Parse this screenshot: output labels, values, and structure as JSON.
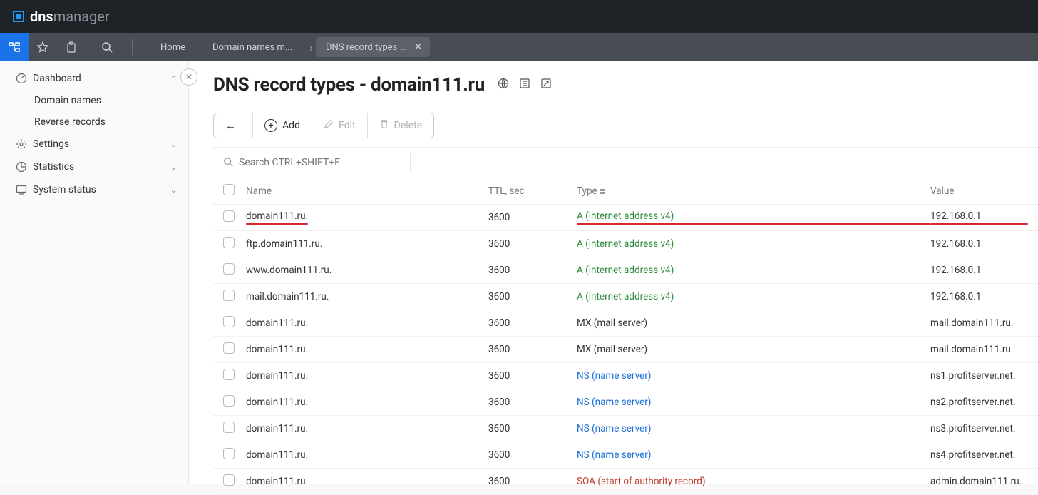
{
  "brand": {
    "prefix": "dns",
    "suffix": "manager"
  },
  "topbar": {
    "crumbs": [
      "Home",
      "Domain names m..."
    ],
    "tab_label": "DNS record types ..."
  },
  "sidebar": {
    "dashboard": {
      "label": "Dashboard",
      "subs": [
        "Domain names",
        "Reverse records"
      ]
    },
    "settings": {
      "label": "Settings"
    },
    "statistics": {
      "label": "Statistics"
    },
    "system_status": {
      "label": "System status"
    }
  },
  "page": {
    "title": "DNS record types - domain111.ru"
  },
  "toolbar": {
    "back": "←",
    "add": "Add",
    "edit": "Edit",
    "delete": "Delete"
  },
  "search": {
    "placeholder": "Search CTRL+SHIFT+F"
  },
  "columns": {
    "name": "Name",
    "ttl": "TTL, sec",
    "type": "Type",
    "value": "Value"
  },
  "records": [
    {
      "name": "domain111.ru.",
      "ttl": "3600",
      "type": "A (internet address v4)",
      "type_class": "type-a",
      "value": "192.168.0.1",
      "highlight": true
    },
    {
      "name": "ftp.domain111.ru.",
      "ttl": "3600",
      "type": "A (internet address v4)",
      "type_class": "type-a",
      "value": "192.168.0.1"
    },
    {
      "name": "www.domain111.ru.",
      "ttl": "3600",
      "type": "A (internet address v4)",
      "type_class": "type-a",
      "value": "192.168.0.1"
    },
    {
      "name": "mail.domain111.ru.",
      "ttl": "3600",
      "type": "A (internet address v4)",
      "type_class": "type-a",
      "value": "192.168.0.1"
    },
    {
      "name": "domain111.ru.",
      "ttl": "3600",
      "type": "MX (mail server)",
      "type_class": "type-mx",
      "value": "mail.domain111.ru."
    },
    {
      "name": "domain111.ru.",
      "ttl": "3600",
      "type": "MX (mail server)",
      "type_class": "type-mx",
      "value": "mail.domain111.ru."
    },
    {
      "name": "domain111.ru.",
      "ttl": "3600",
      "type": "NS (name server)",
      "type_class": "type-ns",
      "value": "ns1.profitserver.net."
    },
    {
      "name": "domain111.ru.",
      "ttl": "3600",
      "type": "NS (name server)",
      "type_class": "type-ns",
      "value": "ns2.profitserver.net."
    },
    {
      "name": "domain111.ru.",
      "ttl": "3600",
      "type": "NS (name server)",
      "type_class": "type-ns",
      "value": "ns3.profitserver.net."
    },
    {
      "name": "domain111.ru.",
      "ttl": "3600",
      "type": "NS (name server)",
      "type_class": "type-ns",
      "value": "ns4.profitserver.net."
    },
    {
      "name": "domain111.ru.",
      "ttl": "3600",
      "type": "SOA (start of authority record)",
      "type_class": "type-soa",
      "value": "admin.domain111.ru."
    }
  ]
}
